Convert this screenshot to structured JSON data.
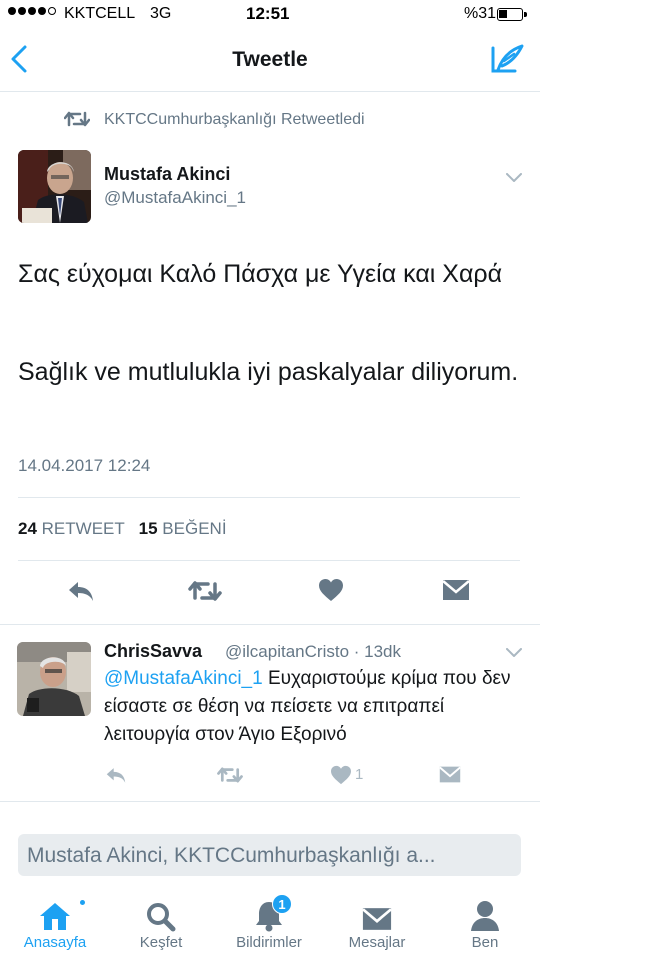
{
  "status_bar": {
    "carrier": "KKTCELL",
    "network": "3G",
    "time": "12:51",
    "battery": "%31"
  },
  "nav": {
    "title": "Tweetle",
    "back_icon": "chevron-left-icon",
    "compose_icon": "compose-icon"
  },
  "retweet_context": {
    "text": "KKTCCumhurbaşkanlığı Retweetledi"
  },
  "tweet": {
    "author_name": "Mustafa Akinci",
    "author_handle": "@MustafaAkinci_1",
    "text_greek": "Σας εύχομαι Καλό Πάσχα με Υγεία και Χαρά",
    "text_turkish": "Sağlık ve mutlulukla iyi paskalyalar diliyorum.",
    "timestamp": "14.04.2017 12:24",
    "retweet_count": "24",
    "retweet_label": "RETWEET",
    "like_count": "15",
    "like_label": "BEĞENİ"
  },
  "reply": {
    "author_name": "ChrisSavva",
    "meta": "@ilcapitanCristo · 13dk",
    "mention": "@MustafaAkinci_1",
    "text": " Ευχαριστούμε κρίμα που δεν είσαστε σε  θέση να πείσετε να επιτραπεί λειτουργία στον Άγιο Εξορινό",
    "like_count": "1"
  },
  "reply_bar": {
    "placeholder": "Mustafa Akinci, KKTCCumhurbaşkanlığı a..."
  },
  "tabs": [
    {
      "label": "Anasayfa",
      "icon": "home-icon",
      "active": true
    },
    {
      "label": "Keşfet",
      "icon": "search-icon",
      "active": false
    },
    {
      "label": "Bildirimler",
      "icon": "bell-icon",
      "active": false,
      "badge": "1"
    },
    {
      "label": "Mesajlar",
      "icon": "mail-icon",
      "active": false
    },
    {
      "label": "Ben",
      "icon": "person-icon",
      "active": false
    }
  ],
  "colors": {
    "accent": "#1da1f2",
    "text": "#14171a",
    "secondary": "#657786",
    "icon_gray": "#657786",
    "light_icon": "#aab8c2"
  }
}
